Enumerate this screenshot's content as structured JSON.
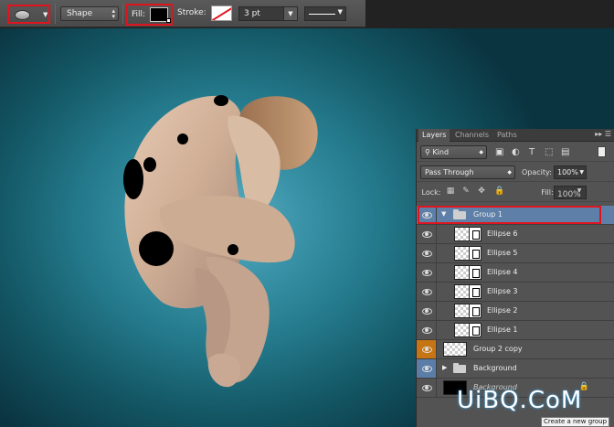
{
  "options_bar": {
    "tool": "ellipse-tool",
    "tool_mode": "Shape",
    "fill_label": "Fill:",
    "fill_color": "#000000",
    "stroke_label": "Stroke:",
    "stroke_color": "none",
    "stroke_width": "3 pt",
    "highlight_color": "#e0141e"
  },
  "layers_panel": {
    "tabs": [
      {
        "label": "Layers",
        "active": true
      },
      {
        "label": "Channels",
        "active": false
      },
      {
        "label": "Paths",
        "active": false
      }
    ],
    "filter_kind": "Kind",
    "blend_mode": "Pass Through",
    "opacity_label": "Opacity:",
    "opacity": "100%",
    "lock_label": "Lock:",
    "fill_label": "Fill:",
    "fill": "100%",
    "layers": [
      {
        "name": "Group 1",
        "type": "group",
        "expanded": true,
        "selected": true
      },
      {
        "name": "Ellipse 6",
        "type": "shape"
      },
      {
        "name": "Ellipse 5",
        "type": "shape"
      },
      {
        "name": "Ellipse 4",
        "type": "shape"
      },
      {
        "name": "Ellipse 3",
        "type": "shape"
      },
      {
        "name": "Ellipse 2",
        "type": "shape"
      },
      {
        "name": "Ellipse 1",
        "type": "shape"
      },
      {
        "name": "Group 2 copy",
        "type": "layer",
        "eye_color": "#c57514"
      },
      {
        "name": "Background",
        "type": "group",
        "expanded": false,
        "eye_color": "#5b7ea9"
      },
      {
        "name": "Background",
        "type": "background",
        "locked": true
      }
    ]
  },
  "tooltip": "Create a new group",
  "watermark": "UiBQ.CoM",
  "canvas": {
    "vignette_center": "#5fb0c4",
    "vignette_edge": "#0a3440"
  }
}
